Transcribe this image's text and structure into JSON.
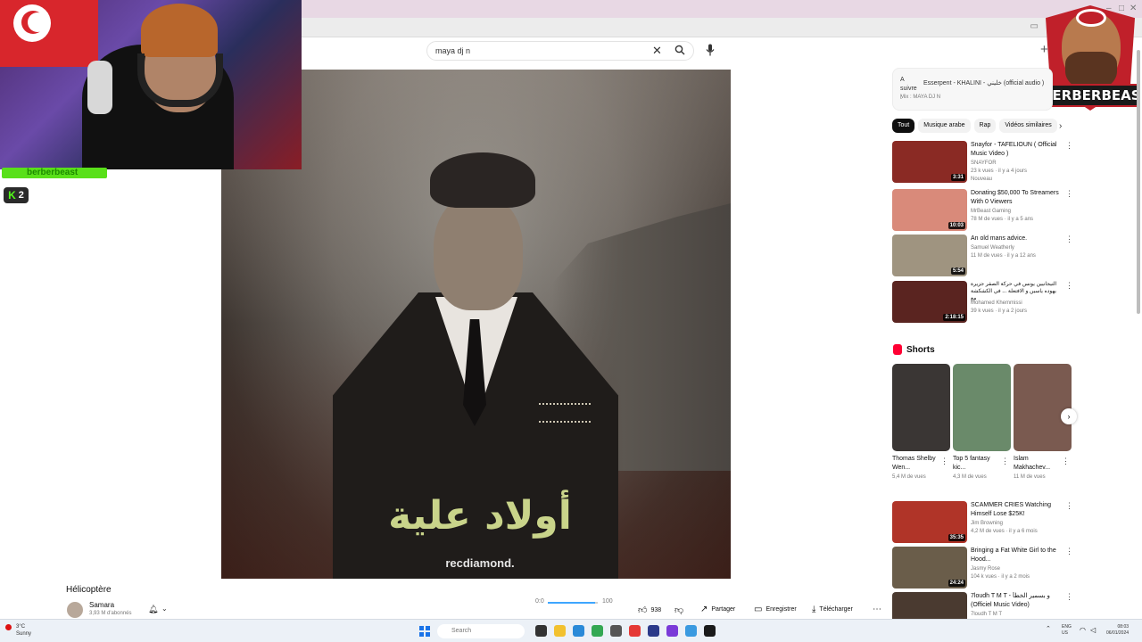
{
  "search": {
    "query": "maya dj n"
  },
  "stream": {
    "tag": "berberbeast",
    "kick_count": "2"
  },
  "logo": {
    "text": "BERBERBEAST"
  },
  "video": {
    "title_ar": "أولاد علية",
    "brand": "recdiamond.",
    "title": "Hélicoptère",
    "channel": "Samara",
    "subscribers": "3,93 M d'abonnés",
    "progress_start": "0:0",
    "progress_end": "100",
    "progress_fraction": 0.95
  },
  "actions": {
    "likes": "938",
    "share": "Partager",
    "save": "Enregistrer",
    "download": "Télécharger"
  },
  "up_next": {
    "label": "A suivre :",
    "title": "Esserpent - KHALINI - خليني (official audio )",
    "subtitle": "Mix : MAYA DJ N"
  },
  "chips": [
    "Tout",
    "Musique arabe",
    "Rap",
    "Vidéos similaires"
  ],
  "recommendations": [
    {
      "title": "Snayfor - TAFELIOUN ( Official Music Video )",
      "channel": "SNAYFOR",
      "meta": "23 k vues · il y a 4 jours",
      "badge": "Nouveau",
      "duration": "3:31",
      "thumb_color": "#8a2a24"
    },
    {
      "title": "Donating $50,000 To Streamers With 0 Viewers",
      "channel": "MrBeast Gaming",
      "meta": "78 M de vues · il y a 5 ans",
      "duration": "10:03",
      "thumb_color": "#d98a7a"
    },
    {
      "title": "An old mans advice.",
      "channel": "Samuel Weatherly",
      "meta": "11 M de vues · il y a 12 ans",
      "duration": "5:54",
      "thumb_color": "#9f9480"
    },
    {
      "title": "التيجانيين يونس في حركة الصقر جزيرة يهوده ياسين و الافتعلة ... في الكشكشة مع",
      "channel": "Mohamed Khemmissi",
      "meta": "39 k vues · il y a 2 jours",
      "duration": "2:18:15",
      "thumb_color": "#5a2420"
    },
    {
      "title": "SCAMMER CRIES Watching Himself Lose $25K!",
      "channel": "Jim Browning",
      "meta": "4,2 M de vues · il y a 6 mois",
      "duration": "35:35",
      "thumb_color": "#b03428"
    },
    {
      "title": "Bringing a Fat White Girl to the Hood...",
      "channel": "Jasmy Rose",
      "meta": "104 k vues · il y a 2 mois",
      "duration": "24:24",
      "thumb_color": "#6a5d4a"
    },
    {
      "title": "7loudh T M T - و بسمير الخطأ (Officiel Music Video)",
      "channel": "7loudh T M T",
      "meta": "",
      "duration": "",
      "thumb_color": "#4a3a30"
    }
  ],
  "shorts": {
    "heading": "Shorts",
    "items": [
      {
        "title": "Thomas Shelby Wen...",
        "views": "5,4 M de vues",
        "thumb_color": "#3a3634"
      },
      {
        "title": "Top 5 fantasy kic...",
        "views": "4,3 M de vues",
        "thumb_color": "#6a8a6a"
      },
      {
        "title": "Islam Makhachev...",
        "views": "11 M de vues",
        "thumb_color": "#7a5a50"
      }
    ]
  },
  "taskbar": {
    "weather_temp": "3°C",
    "weather_desc": "Sunny",
    "search_placeholder": "Search",
    "lang": "ENG",
    "lang_sub": "US",
    "time": "08:03",
    "date": "06/01/2024"
  }
}
